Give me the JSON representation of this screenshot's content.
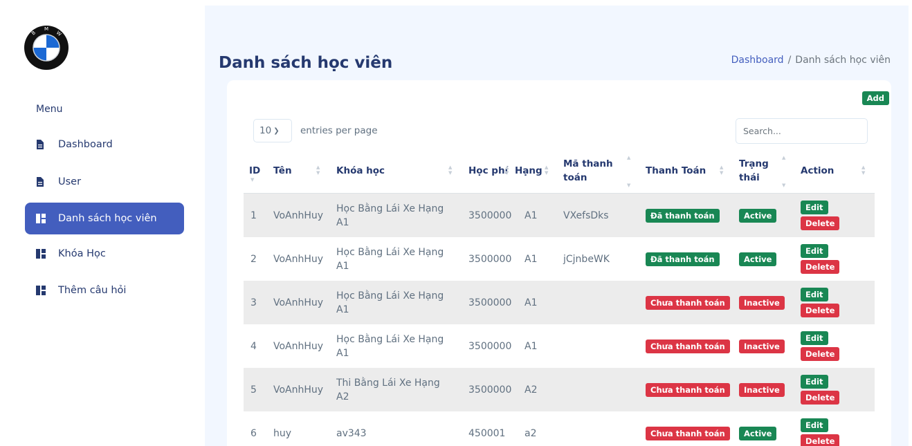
{
  "sidebar": {
    "logo_text": "B M W",
    "menu_title": "Menu",
    "items": [
      {
        "label": "Dashboard",
        "icon": "file-icon",
        "active": false
      },
      {
        "label": "User",
        "icon": "file-icon",
        "active": false
      },
      {
        "label": "Danh sách học viên",
        "icon": "grid-icon",
        "active": true
      },
      {
        "label": "Khóa Học",
        "icon": "grid-icon",
        "active": false
      },
      {
        "label": "Thêm câu hỏi",
        "icon": "grid-icon",
        "active": false
      }
    ]
  },
  "header": {
    "title": "Danh sách học viên",
    "breadcrumb_home": "Dashboard",
    "breadcrumb_sep": "/",
    "breadcrumb_current": "Danh sách học viên"
  },
  "toolbar": {
    "add_label": "Add",
    "entries_value": "10",
    "entries_label": "entries per page",
    "search_placeholder": "Search..."
  },
  "table": {
    "columns": [
      "ID",
      "Tên",
      "Khóa học",
      "Học phí",
      "Hạng",
      "Mã thanh toán",
      "Thanh Toán",
      "Trạng thái",
      "Action"
    ],
    "edit_label": "Edit",
    "delete_label": "Delete",
    "rows": [
      {
        "id": "1",
        "name": "VoAnhHuy",
        "course": "Học Bằng Lái Xe Hạng A1",
        "fee": "3500000",
        "rank": "A1",
        "code": "VXefsDks",
        "payment": "Đã thanh toán",
        "paid": true,
        "status": "Active",
        "active": true
      },
      {
        "id": "2",
        "name": "VoAnhHuy",
        "course": "Học Bằng Lái Xe Hạng A1",
        "fee": "3500000",
        "rank": "A1",
        "code": "jCjnbeWK",
        "payment": "Đã thanh toán",
        "paid": true,
        "status": "Active",
        "active": true
      },
      {
        "id": "3",
        "name": "VoAnhHuy",
        "course": "Học Bằng Lái Xe Hạng A1",
        "fee": "3500000",
        "rank": "A1",
        "code": "",
        "payment": "Chưa thanh toán",
        "paid": false,
        "status": "Inactive",
        "active": false
      },
      {
        "id": "4",
        "name": "VoAnhHuy",
        "course": "Học Bằng Lái Xe Hạng A1",
        "fee": "3500000",
        "rank": "A1",
        "code": "",
        "payment": "Chưa thanh toán",
        "paid": false,
        "status": "Inactive",
        "active": false
      },
      {
        "id": "5",
        "name": "VoAnhHuy",
        "course": "Thi Bằng Lái Xe Hạng A2",
        "fee": "3500000",
        "rank": "A2",
        "code": "",
        "payment": "Chưa thanh toán",
        "paid": false,
        "status": "Inactive",
        "active": false
      },
      {
        "id": "6",
        "name": "huy",
        "course": "av343",
        "fee": "450001",
        "rank": "a2",
        "code": "",
        "payment": "Chưa thanh toán",
        "paid": false,
        "status": "Active",
        "active": true
      }
    ]
  },
  "colors": {
    "accent": "#435ebe",
    "success": "#198754",
    "danger": "#dc3545",
    "background": "#f2f7ff",
    "text": "#25396f"
  }
}
